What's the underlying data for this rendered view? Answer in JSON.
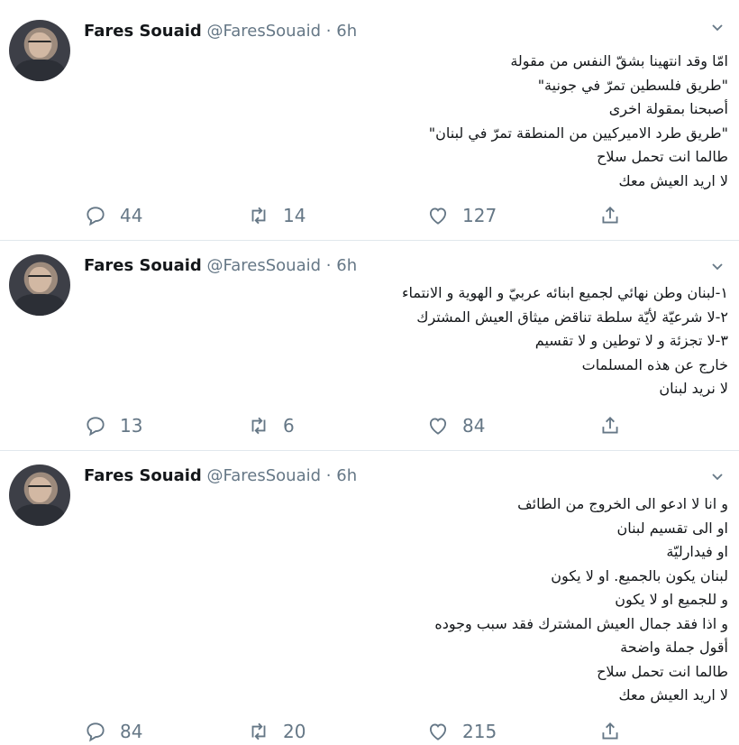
{
  "tweets": [
    {
      "name": "Fares Souaid",
      "handle": "@FaresSouaid",
      "dot": "·",
      "time": "6h",
      "lines": [
        "امّا وقد انتهينا بشقّ النفس من مقولة",
        "\"طريق فلسطين تمرّ في جونية\"",
        "أصبحنا بمقولة اخرى",
        "\"طريق طرد الاميركيين من المنطقة تمرّ في لبنان\"",
        "طالما انت تحمل سلاح",
        "لا اريد العيش معك"
      ],
      "replies": "44",
      "retweets": "14",
      "likes": "127"
    },
    {
      "name": "Fares Souaid",
      "handle": "@FaresSouaid",
      "dot": "·",
      "time": "6h",
      "lines": [
        "١-لبنان وطن نهائي لجميع ابنائه عربيّ و الهوية و الانتماء",
        "٢-لا شرعيّة لأيّة سلطة تناقض ميثاق العيش المشترك",
        "٣-لا تجزئة و لا توطين و لا تقسيم",
        "خارج عن هذه المسلمات",
        "لا نريد لبنان"
      ],
      "replies": "13",
      "retweets": "6",
      "likes": "84"
    },
    {
      "name": "Fares Souaid",
      "handle": "@FaresSouaid",
      "dot": "·",
      "time": "6h",
      "lines": [
        "و انا لا ادعو الى الخروج من الطائف",
        "او الى تقسيم لبنان",
        "او فيدارليّة",
        "لبنان يكون بالجميع. او لا يكون",
        "و للجميع او لا يكون",
        "و اذا فقد جمال العيش المشترك فقد سبب وجوده",
        "أقول جملة واضحة",
        "طالما انت تحمل سلاح",
        "لا اريد العيش معك"
      ],
      "replies": "84",
      "retweets": "20",
      "likes": "215"
    }
  ]
}
